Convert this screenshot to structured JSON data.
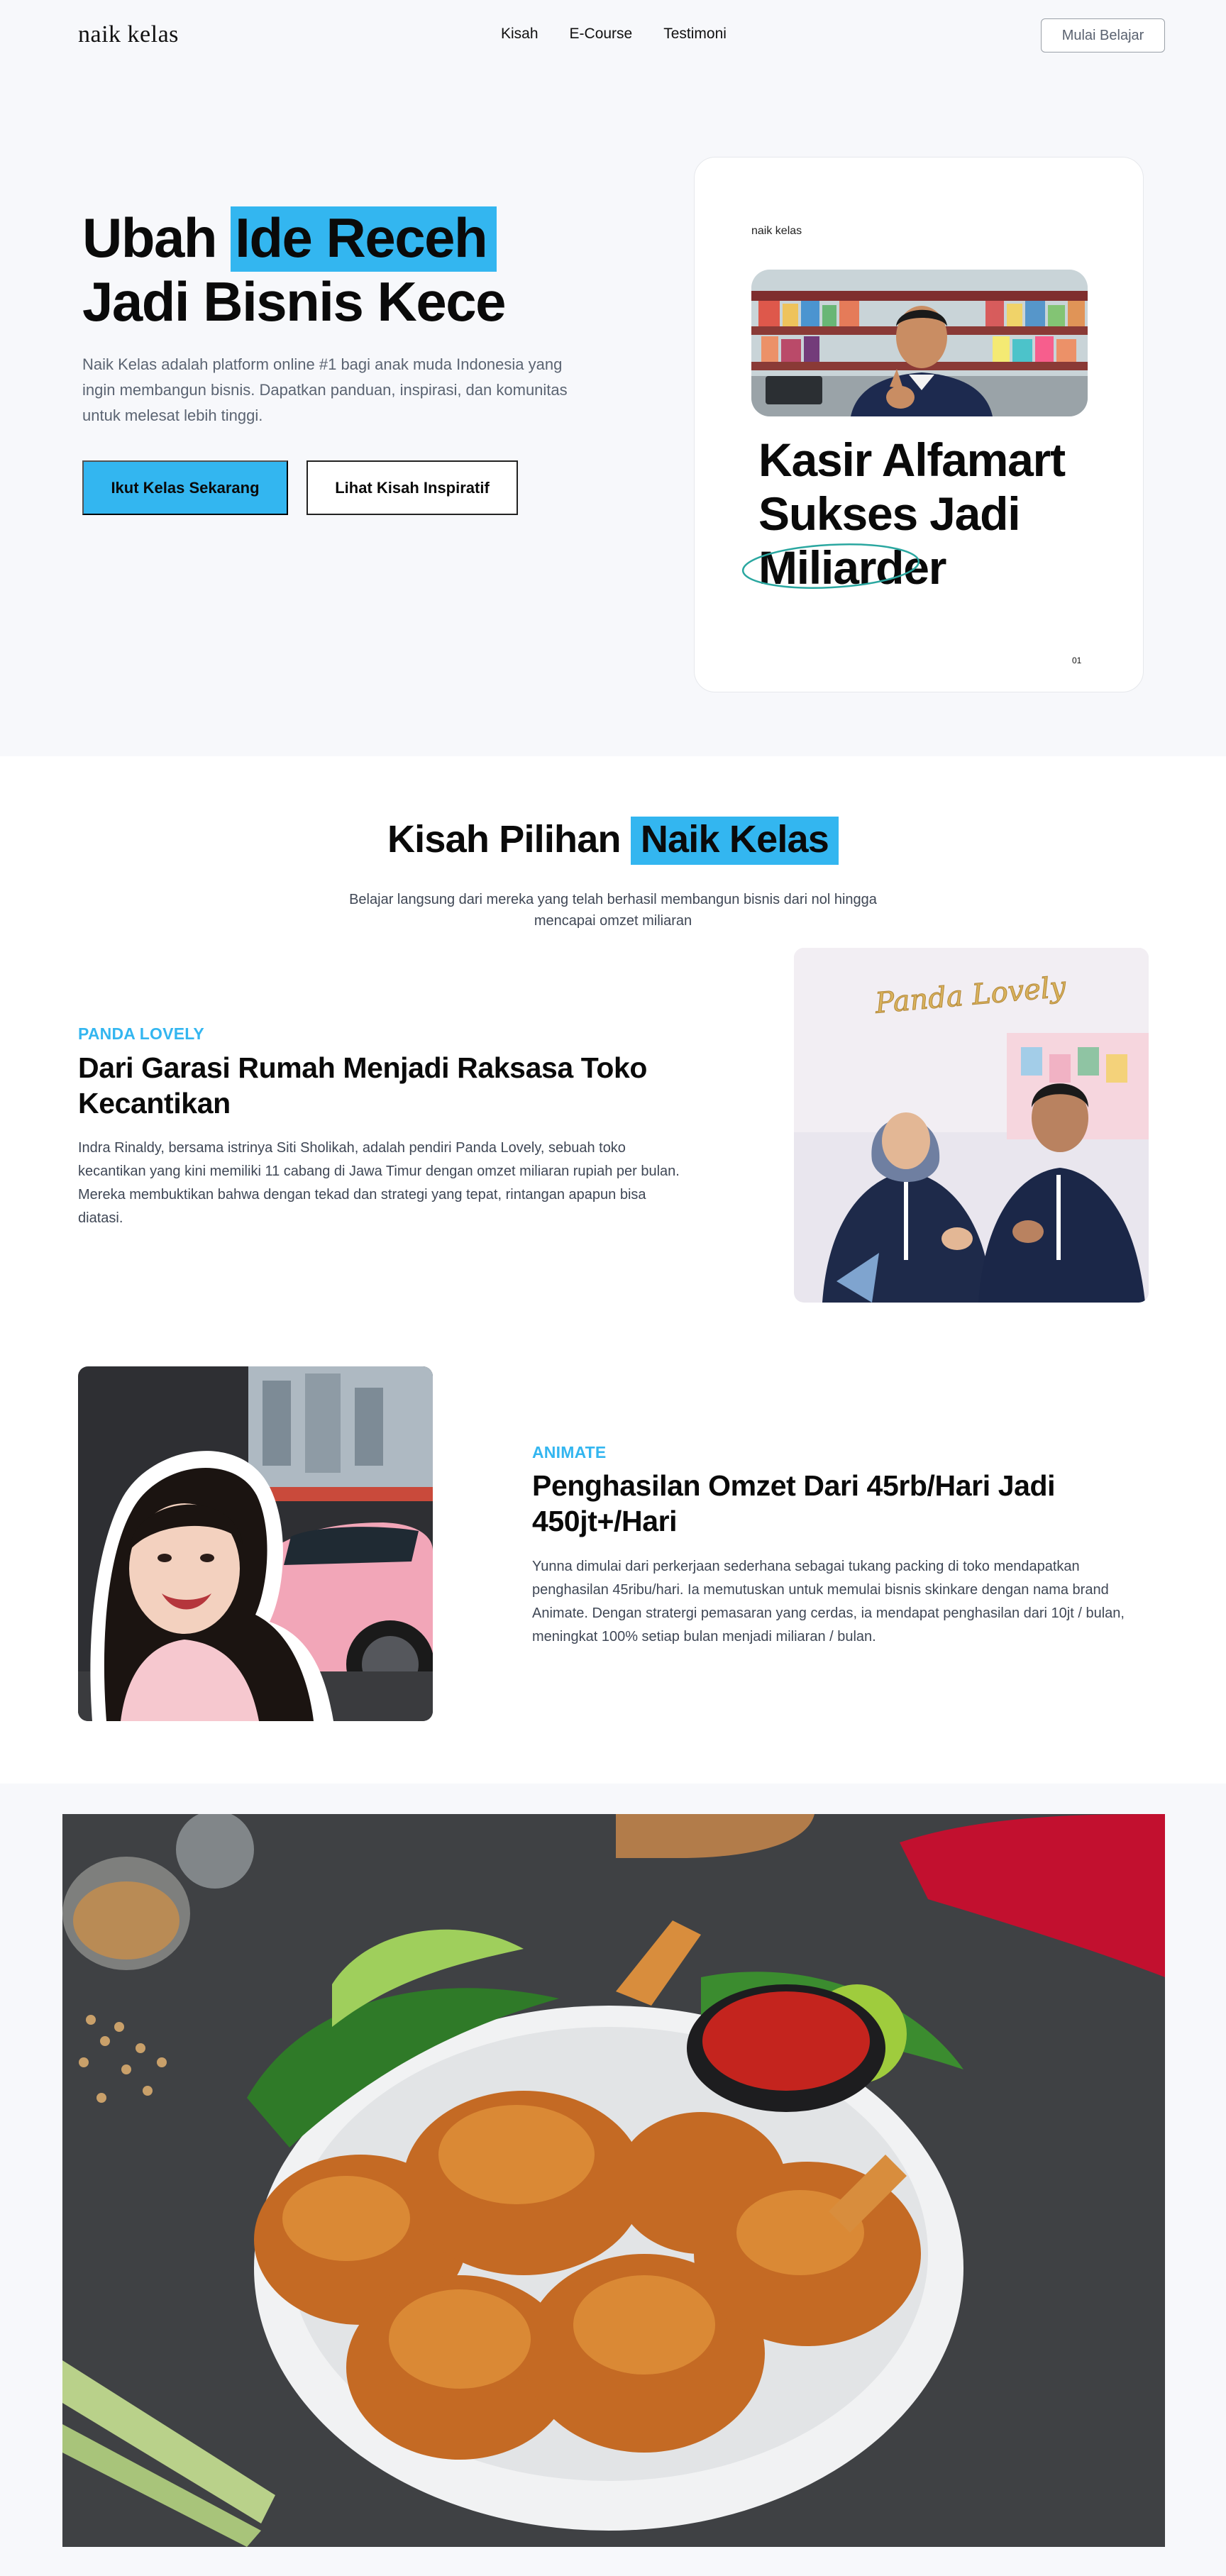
{
  "nav": {
    "logo": "naik kelas",
    "links": [
      "Kisah",
      "E-Course",
      "Testimoni"
    ],
    "cta": "Mulai Belajar"
  },
  "hero": {
    "title_part1": "Ubah ",
    "title_highlight": "Ide Receh",
    "title_line2": "Jadi Bisnis Kece",
    "description": "Naik Kelas adalah platform online #1 bagi anak muda Indonesia yang ingin membangun bisnis. Dapatkan panduan, inspirasi, dan komunitas untuk melesat lebih tinggi.",
    "primary_button": "Ikut Kelas Sekarang",
    "secondary_button": "Lihat Kisah Inspiratif",
    "card": {
      "brand": "naik kelas",
      "line1": "Kasir Alfamart",
      "line2": "Sukses Jadi",
      "line3": "Miliarder",
      "page": "01"
    }
  },
  "stories": {
    "title_part1": "Kisah Pilihan ",
    "title_highlight": "Naik Kelas",
    "subtitle": "Belajar langsung dari mereka yang telah berhasil membangun bisnis dari nol hingga mencapai omzet miliaran",
    "items": [
      {
        "tag": "PANDA LOVELY",
        "title": "Dari Garasi Rumah Menjadi Raksasa Toko Kecantikan",
        "description": "Indra Rinaldy, bersama istrinya Siti Sholikah, adalah pendiri Panda Lovely, sebuah toko kecantikan yang kini memiliki 11 cabang di Jawa Timur dengan omzet miliaran rupiah per bulan. Mereka membuktikan bahwa dengan tekad dan strategi yang tepat, rintangan apapun bisa diatasi.",
        "image_sign": "Panda Lovely"
      },
      {
        "tag": "ANIMATE",
        "title": "Penghasilan Omzet Dari 45rb/Hari Jadi 450jt+/Hari",
        "description": "Yunna dimulai dari perkerjaan sederhana sebagai tukang packing di toko mendapatkan penghasilan 45ribu/hari. Ia memutuskan untuk memulai bisnis skinkare dengan nama brand Animate. Dengan stratergi pemasaran yang cerdas, ia mendapat penghasilan dari 10jt / bulan, meningkat 100% setiap bulan menjadi miliaran / bulan."
      }
    ]
  },
  "colors": {
    "accent": "#33b6f0",
    "background": "#f7f8fb",
    "text": "#0a0a0a",
    "muted": "#5b6472"
  }
}
